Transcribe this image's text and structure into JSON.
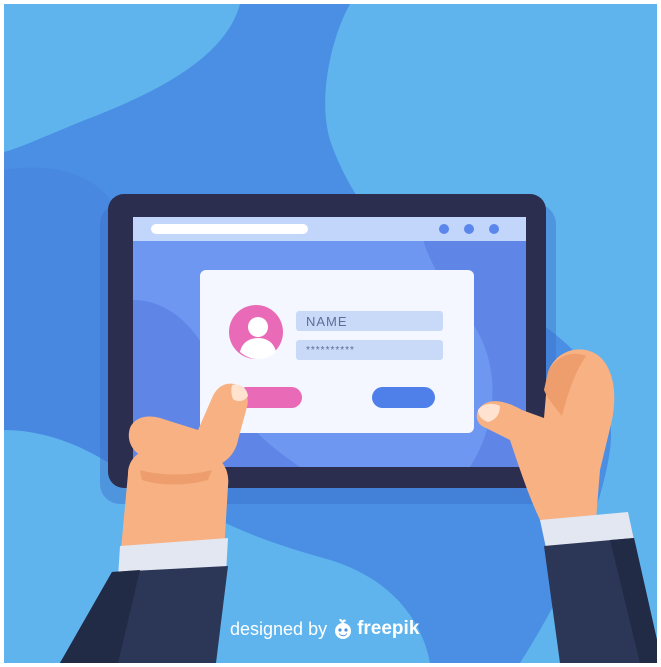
{
  "login_form": {
    "name_placeholder": "NAME",
    "password_placeholder": "**********"
  },
  "watermark": {
    "prefix": "designed by",
    "brand": "freepik",
    "logo_icon": "freepik-logo-icon"
  },
  "colors": {
    "background_blue": "#4a8fe3",
    "background_light_blue": "#5fb4ee",
    "tablet_frame": "#2b2e4e",
    "screen_blue": "#6d97f1",
    "login_card": "#f4f7ff",
    "input_fill": "#c9d9f8",
    "avatar_pink": "#e96ab6",
    "login_button_pink": "#e96ab6",
    "submit_button_blue": "#4f80ea",
    "skin": "#f7b183",
    "sleeve": "#2c3656"
  }
}
